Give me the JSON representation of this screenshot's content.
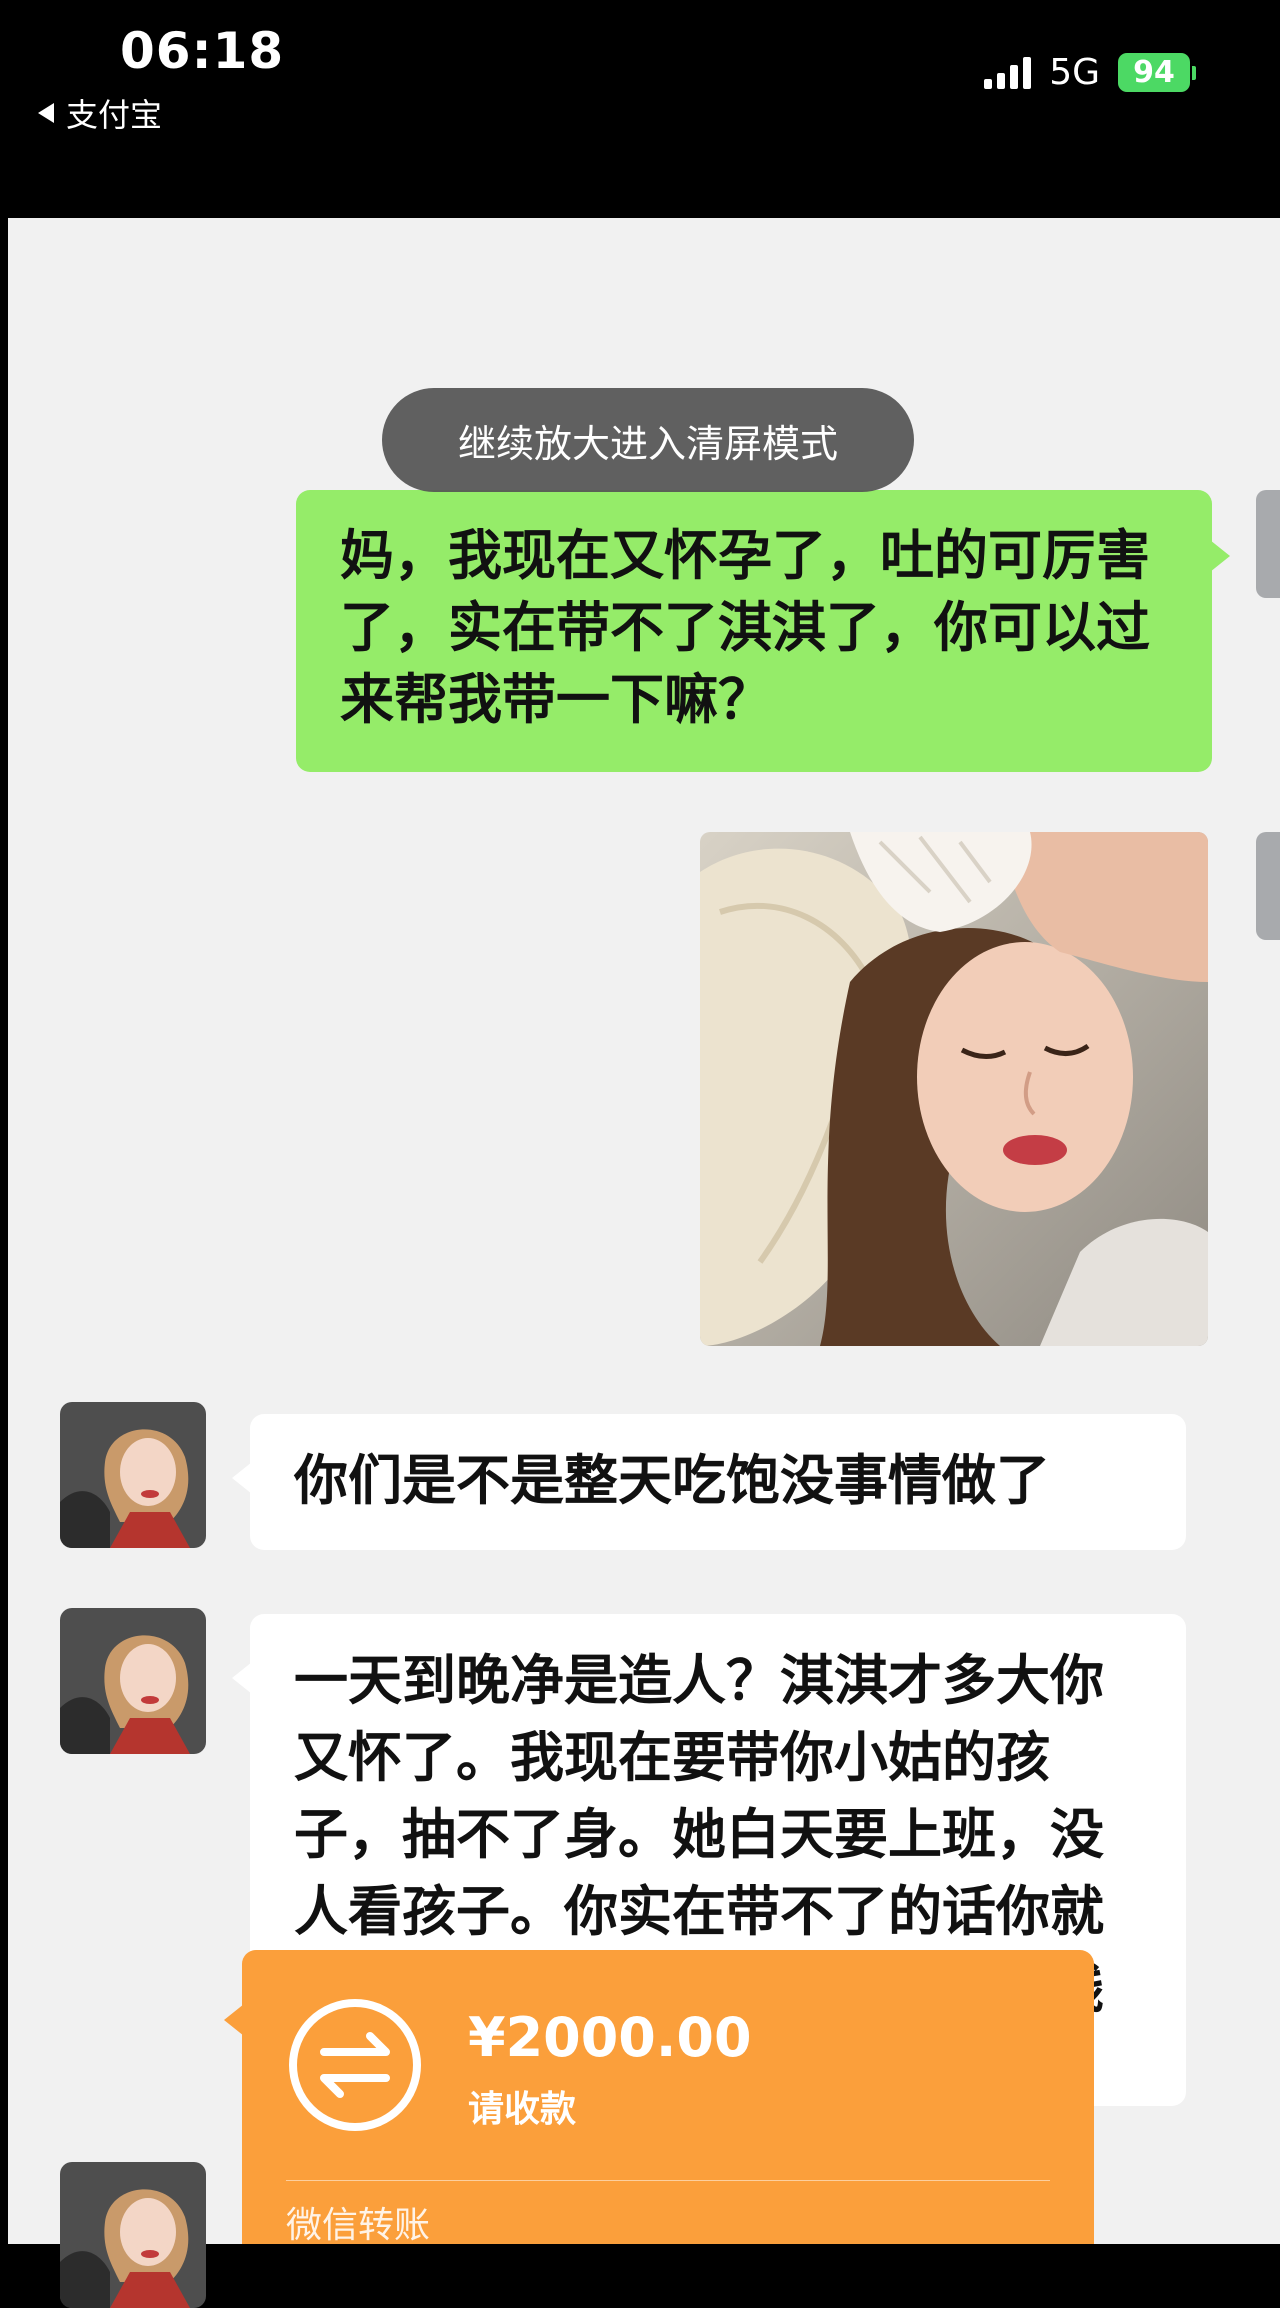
{
  "status_bar": {
    "time": "06:18",
    "back_app": "支付宝",
    "network": "5G",
    "battery": "94"
  },
  "toast": "继续放大进入清屏模式",
  "messages": [
    {
      "sender": "self",
      "type": "text",
      "text": "妈，我现在又怀孕了，吐的可厉害了，实在带不了淇淇了，你可以过来帮我带一下嘛？"
    },
    {
      "sender": "self",
      "type": "image"
    },
    {
      "sender": "other",
      "type": "text",
      "text": "你们是不是整天吃饱没事情做了"
    },
    {
      "sender": "other",
      "type": "text",
      "text": "一天到晚净是造人？淇淇才多大你又怀了。我现在要带你小姑的孩子，抽不了身。她白天要上班，没人看孩子。你实在带不了的话你就叫你妈来给你看一段吧！给她点钱就得了"
    },
    {
      "sender": "other",
      "type": "transfer",
      "amount": "¥2000.00",
      "status": "请收款",
      "source": "微信转账"
    }
  ],
  "colors": {
    "self_bubble": "#95ec69",
    "other_bubble": "#ffffff",
    "transfer": "#fb9f3b",
    "chat_bg": "#f1f1f1"
  },
  "icons": [
    "back-arrow-icon",
    "signal-icon",
    "battery-icon",
    "transfer-arrows-icon"
  ]
}
